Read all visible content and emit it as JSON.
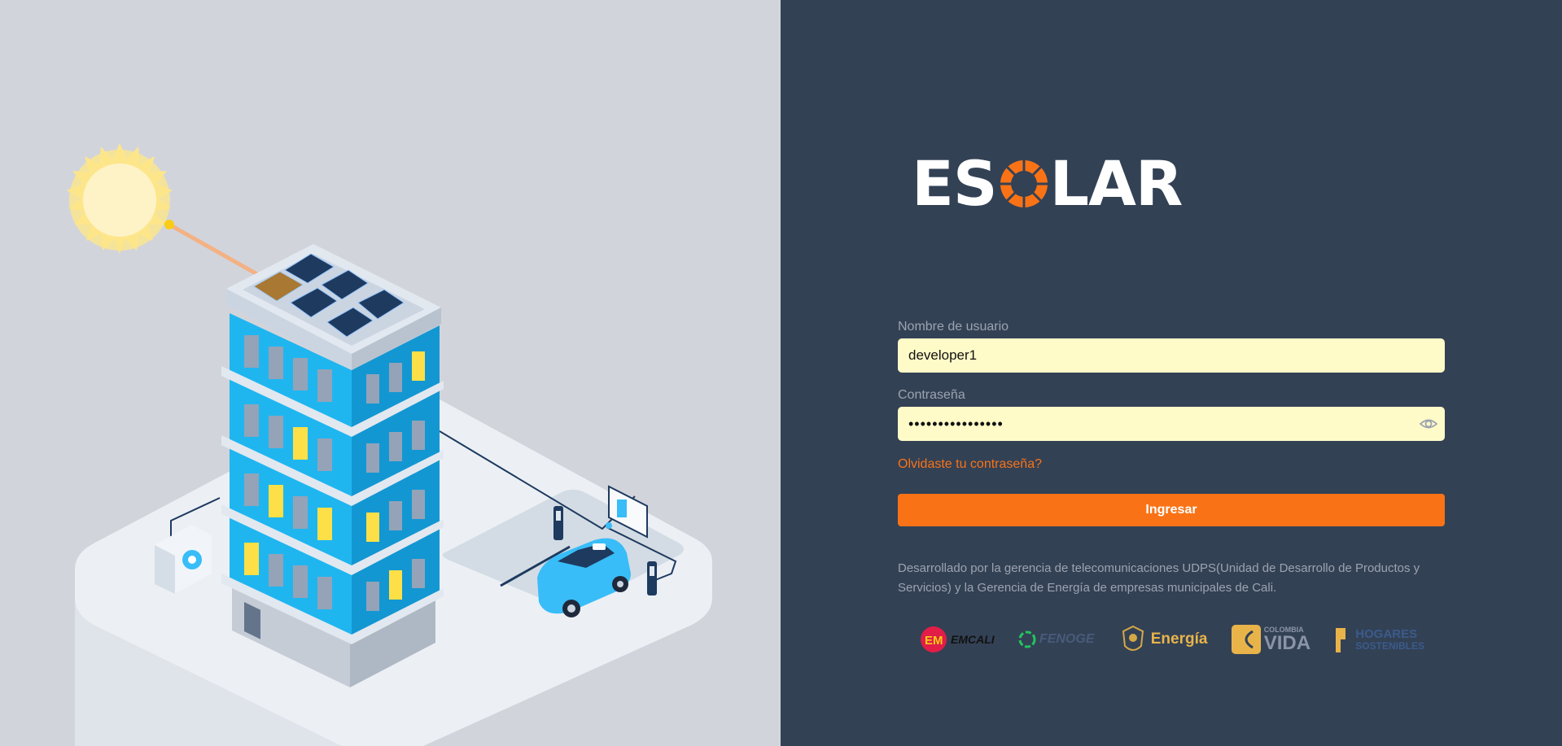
{
  "brand": {
    "name_prefix": "ES",
    "name_suffix": "LAR",
    "accent": "#f97316"
  },
  "login": {
    "username_label": "Nombre de usuario",
    "username_value": "developer1",
    "password_label": "Contraseña",
    "password_value": "password12345678",
    "forgot_link": "Olvidaste tu contraseña?",
    "submit_label": "Ingresar",
    "footnote": "Desarrollado por la gerencia de telecomunicaciones UDPS(Unidad de Desarrollo de Productos y Servicios) y la Gerencia de Energía de empresas municipales de Cali."
  },
  "partners": {
    "emcali": "EMCALI",
    "fenoge": "FENOGE",
    "energia": "Energía",
    "colombia": "COLOMBIA",
    "vida": "VIDA",
    "hogares": "HOGARES",
    "sostenibles": "SOSTENIBLES"
  },
  "icons": [
    "eye-icon",
    "sun-icon",
    "solar-panel-icon",
    "building-icon",
    "electric-car-icon",
    "charger-icon",
    "battery-icon",
    "ac-unit-icon"
  ],
  "colors": {
    "left_bg": "#d2d4dc",
    "right_bg": "#334155",
    "input_bg": "#fffbc8",
    "button": "#f97316",
    "muted_text": "#9ca3af"
  }
}
